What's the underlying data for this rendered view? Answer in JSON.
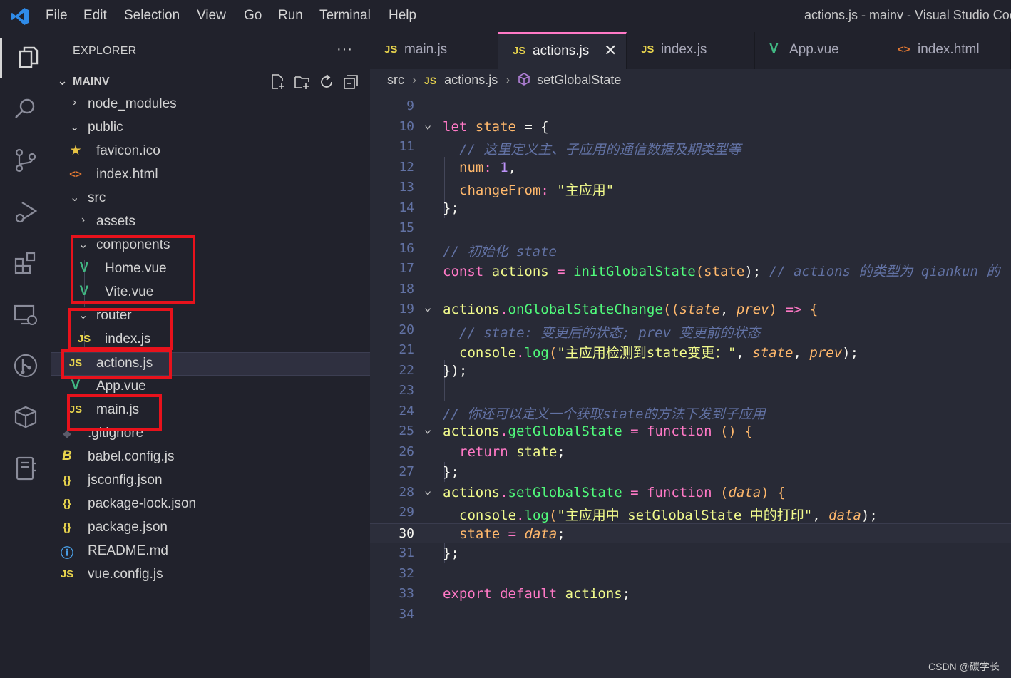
{
  "titlebar": {
    "menu": [
      "File",
      "Edit",
      "Selection",
      "View",
      "Go",
      "Run",
      "Terminal",
      "Help"
    ],
    "window_title": "actions.js - mainv - Visual Studio Coc"
  },
  "activity_bar": [
    "explorer-icon",
    "search-icon",
    "source-control-icon",
    "run-debug-icon",
    "extensions-icon",
    "remote-explorer-icon",
    "git-graph-icon",
    "package-icon",
    "notebook-icon"
  ],
  "sidebar": {
    "title": "EXPLORER",
    "more": "···",
    "root": "MAINV",
    "tree": [
      {
        "label": "node_modules",
        "icon": "",
        "chev": "›"
      },
      {
        "label": "public",
        "icon": "",
        "chev": "⌄"
      },
      {
        "label": "favicon.ico",
        "icon": "★",
        "chev": ""
      },
      {
        "label": "index.html",
        "icon": "<>",
        "chev": ""
      },
      {
        "label": "src",
        "icon": "",
        "chev": "⌄"
      },
      {
        "label": "assets",
        "icon": "",
        "chev": "›"
      },
      {
        "label": "components",
        "icon": "",
        "chev": "⌄"
      },
      {
        "label": "Home.vue",
        "icon": "V",
        "chev": ""
      },
      {
        "label": "Vite.vue",
        "icon": "V",
        "chev": ""
      },
      {
        "label": "router",
        "icon": "",
        "chev": "⌄"
      },
      {
        "label": "index.js",
        "icon": "JS",
        "chev": ""
      },
      {
        "label": "actions.js",
        "icon": "JS",
        "chev": ""
      },
      {
        "label": "App.vue",
        "icon": "V",
        "chev": ""
      },
      {
        "label": "main.js",
        "icon": "JS",
        "chev": ""
      },
      {
        "label": ".gitignore",
        "icon": "◆",
        "chev": ""
      },
      {
        "label": "babel.config.js",
        "icon": "B",
        "chev": ""
      },
      {
        "label": "jsconfig.json",
        "icon": "{}",
        "chev": ""
      },
      {
        "label": "package-lock.json",
        "icon": "{}",
        "chev": ""
      },
      {
        "label": "package.json",
        "icon": "{}",
        "chev": ""
      },
      {
        "label": "README.md",
        "icon": "ⓘ",
        "chev": ""
      },
      {
        "label": "vue.config.js",
        "icon": "JS",
        "chev": ""
      }
    ]
  },
  "tabs": [
    {
      "label": "main.js",
      "icon": "JS"
    },
    {
      "label": "actions.js",
      "icon": "JS",
      "close": "✕"
    },
    {
      "label": "index.js",
      "icon": "JS"
    },
    {
      "label": "App.vue",
      "icon": "V"
    },
    {
      "label": "index.html",
      "icon": "<>"
    }
  ],
  "breadcrumb": {
    "folder": "src",
    "file_icon": "JS",
    "file": "actions.js",
    "symbol": "setGlobalState"
  },
  "code": {
    "line_numbers": [
      "9",
      "10",
      "11",
      "12",
      "13",
      "14",
      "15",
      "16",
      "17",
      "18",
      "19",
      "20",
      "21",
      "22",
      "23",
      "24",
      "25",
      "26",
      "27",
      "28",
      "29",
      "30",
      "31",
      "32",
      "33",
      "34"
    ],
    "t10_1": "let",
    "t10_2": "state",
    "t10_3": " = {",
    "t11": "// 这里定义主、子应用的通信数据及期类型等",
    "t12_1": "num",
    "t12_2": ": ",
    "t12_3": "1",
    ",": ",",
    "t13_1": "changeFrom",
    "t13_2": ": ",
    "t13_3": "\"主应用\"",
    "t14": "};",
    "t16": "// 初始化 state",
    "t17_1": "const",
    "t17_2": "actions",
    "t17_3": " = ",
    "t17_4": "initGlobalState",
    "t17_5": "(",
    "t17_6": "state",
    "t17_7": "); ",
    "t17_8": "// actions 的类型为 qiankun 的",
    "t19_1": "actions",
    "t19_2": ".",
    "t19_3": "onGlobalStateChange",
    "t19_4": "((",
    "t19_5": "state",
    "t19_6": ", ",
    "t19_7": "prev",
    "t19_8": ") ",
    "t19_9": "=>",
    "t19_10": " {",
    "t20": "// state: 变更后的状态; prev 变更前的状态",
    "t21_1": "console",
    "t21_2": ".",
    "t21_3": "log",
    "t21_4": "(",
    "t21_5": "\"主应用检测到state变更：\"",
    "t21_6": ", ",
    "t21_7": "state",
    "t21_8": ", ",
    "t21_9": "prev",
    "t21_10": ");",
    "t22": "});",
    "t24": "// 你还可以定义一个获取state的方法下发到子应用",
    "t25_1": "actions",
    "t25_2": ".",
    "t25_3": "getGlobalState",
    "t25_4": " = ",
    "t25_5": "function",
    "t25_6": " () {",
    "t26_1": "return",
    "t26_2": "state",
    ";": ";",
    "t27": "};",
    "t28_1": "actions",
    "t28_2": ".",
    "t28_3": "setGlobalState",
    "t28_4": " = ",
    "t28_5": "function",
    "t28_6": " (",
    "t28_7": "data",
    "t28_8": ") {",
    "t29_1": "console",
    "t29_2": ".",
    "t29_3": "log",
    "t29_4": "(",
    "t29_5": "\"主应用中 setGlobalState 中的打印\"",
    "t29_6": ", ",
    "t29_7": "data",
    "t29_8": ");",
    "t30_1": "state",
    "t30_2": " = ",
    "t30_3": "data",
    "t30_4": ";",
    "t31": "};",
    "t33_1": "export",
    "t33_2": "default",
    "t33_3": "actions",
    "t33_4": ";"
  },
  "watermark": "CSDN @碳学长",
  "colors": {
    "highlight_box": "#e8121c",
    "active_tab_border": "#ff79c6",
    "editor_bg": "#282a36",
    "sidebar_bg": "#21222c"
  }
}
